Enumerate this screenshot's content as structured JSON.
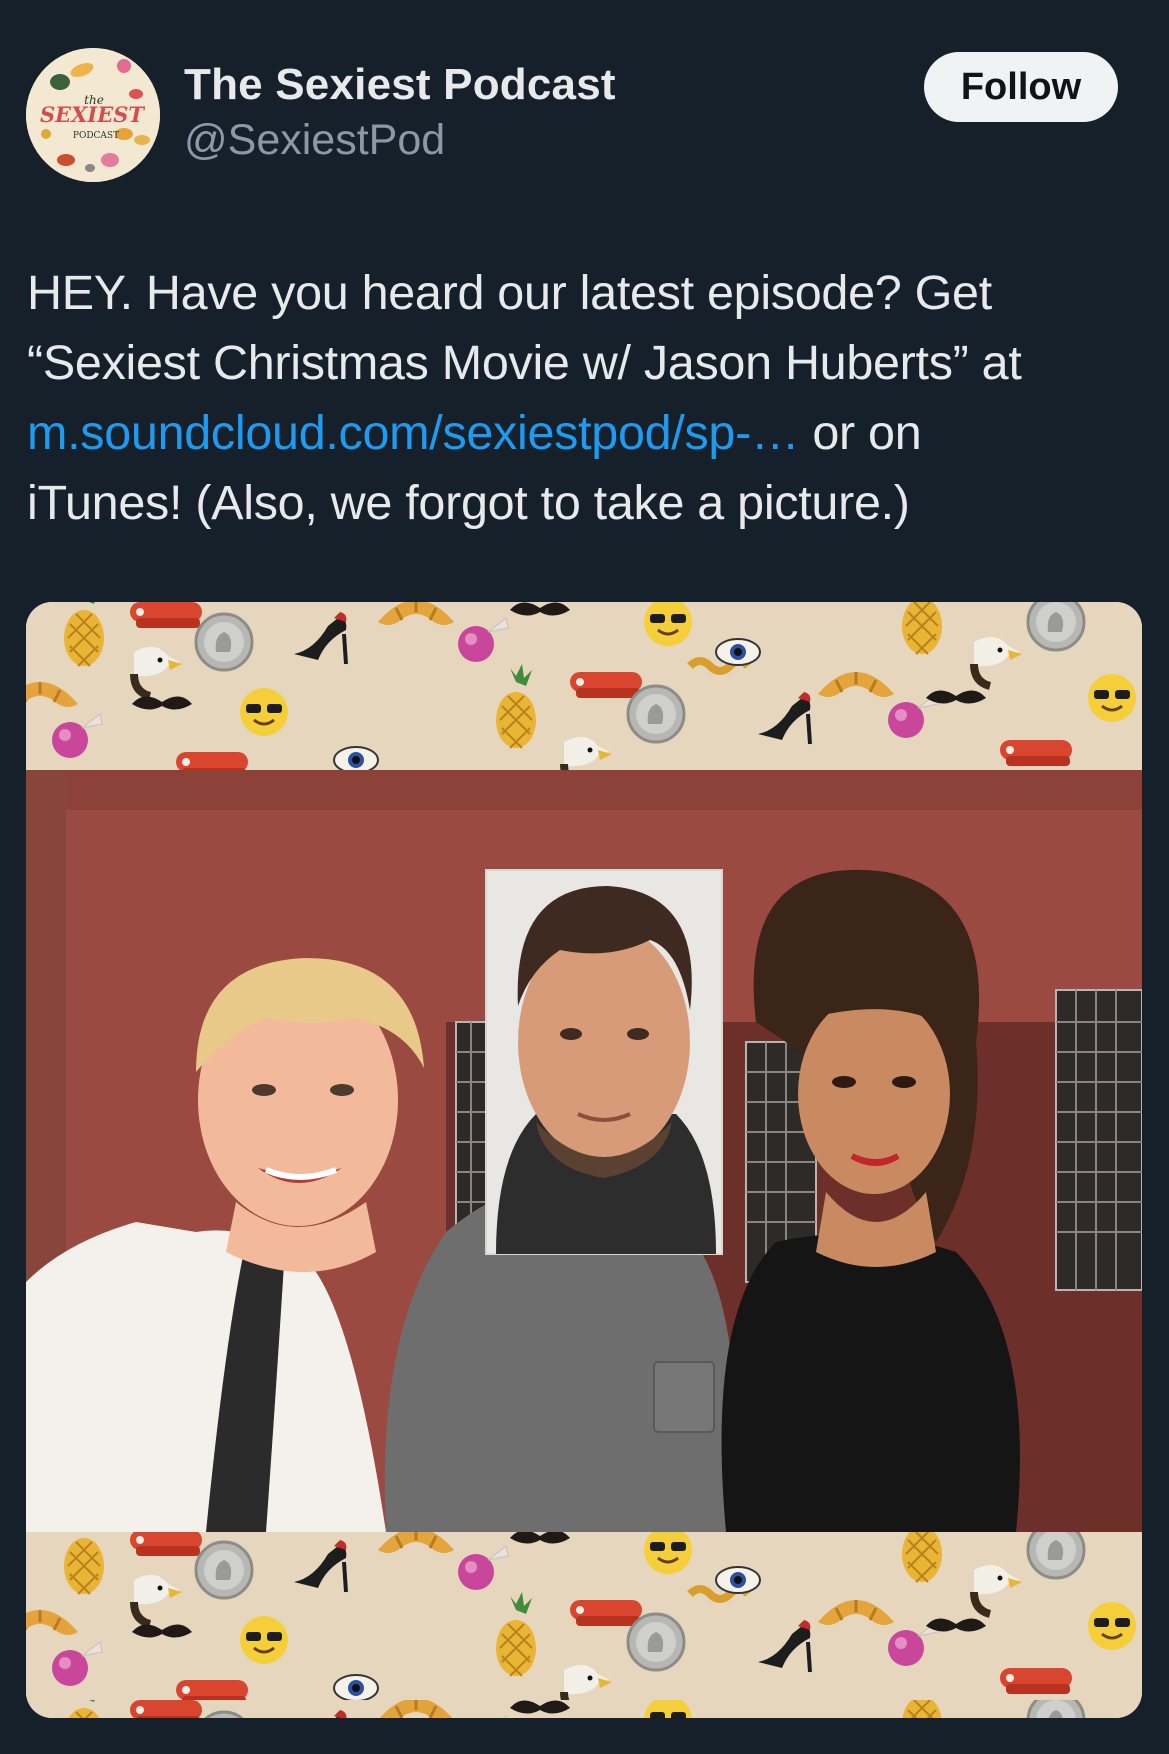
{
  "account": {
    "display_name": "The Sexiest Podcast",
    "handle": "@SexiestPod",
    "avatar_text": {
      "line1": "the",
      "line2": "SEXIEST",
      "line3": "PODCAST"
    }
  },
  "follow_button": {
    "label": "Follow"
  },
  "tweet": {
    "line1": "HEY. Have you heard our latest episode? Get",
    "line2": "“Sexiest Christmas Movie w/ Jason Huberts” at",
    "link": "m.soundcloud.com/sexiestpod/sp-…",
    "line3_after_link": " or on",
    "line4": "iTunes! (Also, we forgot to take a picture.)"
  },
  "media": {
    "icons": [
      "pineapple-icon",
      "stapler-icon",
      "coin-icon",
      "high-heel-icon",
      "croissant-icon",
      "candy-icon",
      "sunglasses-emoji-icon",
      "eagle-icon",
      "gold-chain-icon",
      "eye-icon",
      "mustache-icon"
    ]
  },
  "colors": {
    "background": "#15202b",
    "text": "#e7e9ea",
    "secondary_text": "#8b98a5",
    "link": "#1d9bf0",
    "follow_button_bg": "#eff3f4",
    "pattern_bg": "#e5d6bd",
    "wall": "#9a4a40"
  }
}
